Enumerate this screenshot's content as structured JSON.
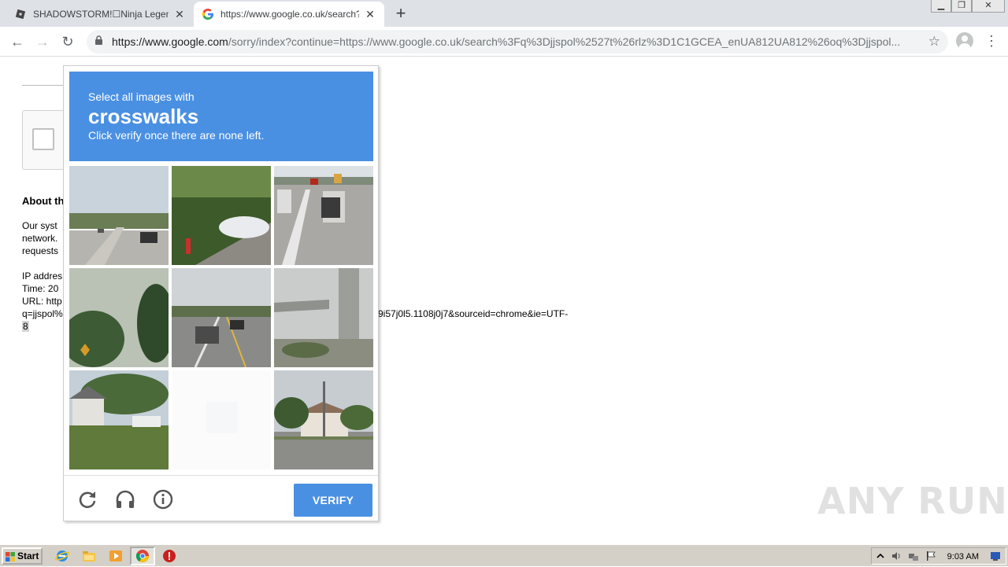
{
  "browser": {
    "tabs": [
      {
        "title": "SHADOWSTORM!☐Ninja Legends - R",
        "active": false,
        "favicon": "roblox-icon"
      },
      {
        "title": "https://www.google.co.uk/search?q",
        "active": true,
        "favicon": "google-g-icon"
      }
    ],
    "address": {
      "host": "https://www.google.com",
      "rest": "/sorry/index?continue=https://www.google.co.uk/search%3Fq%3Djjspol%2527t%26rlz%3D1C1GCEA_enUA812UA812%26oq%3Djjspol..."
    }
  },
  "page": {
    "about": "About th",
    "lines": [
      "Our syst",
      "network.",
      "requests"
    ],
    "ip_lines": [
      "IP addres",
      "Time: 20",
      "URL: http",
      "q=jjspol%"
    ],
    "url_tail": "9i57j0l5.1108j0j7&sourceid=chrome&ie=UTF-",
    "url_last": "8"
  },
  "captcha": {
    "prompt": "Select all images with",
    "target": "crosswalks",
    "instruction": "Click verify once there are none left.",
    "verify_label": "VERIFY",
    "accent": "#4a90e2"
  },
  "watermark": "ANY RUN",
  "taskbar": {
    "start_label": "Start",
    "clock": "9:03 AM"
  }
}
